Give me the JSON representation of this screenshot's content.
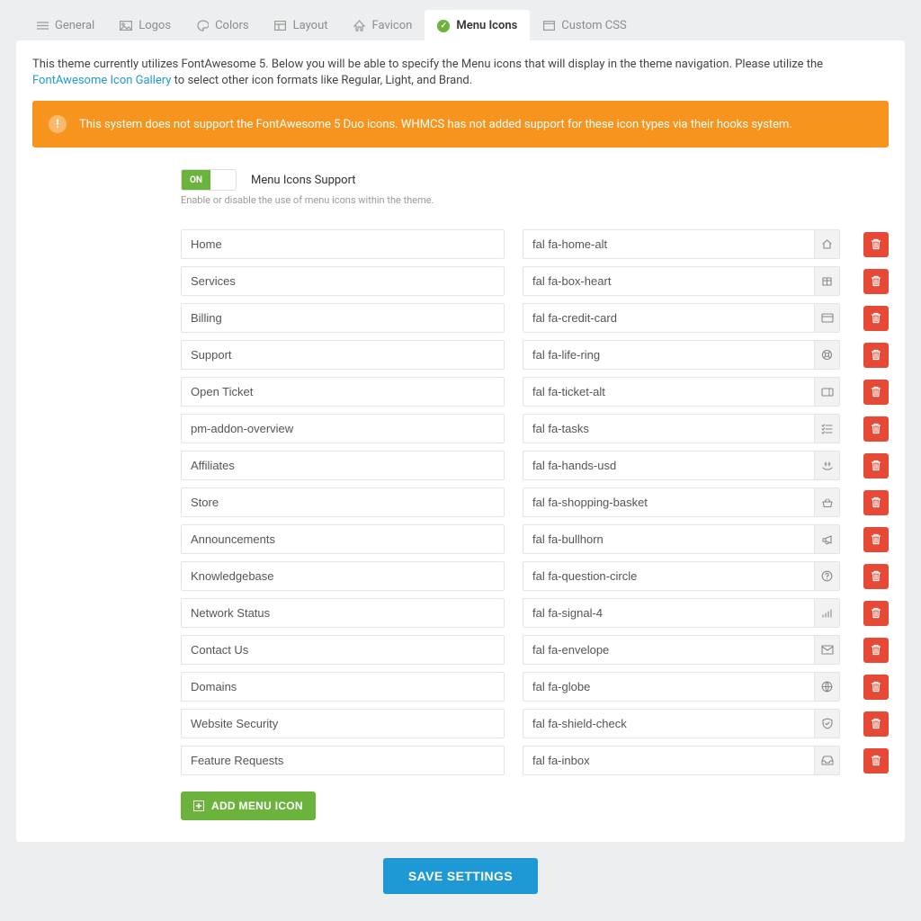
{
  "tabs": [
    {
      "id": "general",
      "label": "General"
    },
    {
      "id": "logos",
      "label": "Logos"
    },
    {
      "id": "colors",
      "label": "Colors"
    },
    {
      "id": "layout",
      "label": "Layout"
    },
    {
      "id": "favicon",
      "label": "Favicon"
    },
    {
      "id": "menu-icons",
      "label": "Menu Icons",
      "active": true
    },
    {
      "id": "custom-css",
      "label": "Custom CSS"
    }
  ],
  "intro": {
    "before": "This theme currently utilizes FontAwesome 5. Below you will be able to specify the Menu icons that will display in the theme navigation. Please utilize the ",
    "link": "FontAwesome Icon Gallery",
    "after": " to select other icon formats like Regular, Light, and Brand."
  },
  "alert": "This system does not support the FontAwesome 5 Duo icons. WHMCS has not added support for these icon types via their hooks system.",
  "toggle": {
    "state": "ON",
    "label": "Menu Icons Support",
    "hint": "Enable or disable the use of menu icons within the theme."
  },
  "rows": [
    {
      "name": "Home",
      "icon": "fal fa-home-alt",
      "glyph": "home"
    },
    {
      "name": "Services",
      "icon": "fal fa-box-heart",
      "glyph": "box"
    },
    {
      "name": "Billing",
      "icon": "fal fa-credit-card",
      "glyph": "card"
    },
    {
      "name": "Support",
      "icon": "fal fa-life-ring",
      "glyph": "ring"
    },
    {
      "name": "Open Ticket",
      "icon": "fal fa-ticket-alt",
      "glyph": "ticket"
    },
    {
      "name": "pm-addon-overview",
      "icon": "fal fa-tasks",
      "glyph": "tasks"
    },
    {
      "name": "Affiliates",
      "icon": "fal fa-hands-usd",
      "glyph": "hands"
    },
    {
      "name": "Store",
      "icon": "fal fa-shopping-basket",
      "glyph": "basket"
    },
    {
      "name": "Announcements",
      "icon": "fal fa-bullhorn",
      "glyph": "horn"
    },
    {
      "name": "Knowledgebase",
      "icon": "fal fa-question-circle",
      "glyph": "question"
    },
    {
      "name": "Network Status",
      "icon": "fal fa-signal-4",
      "glyph": "signal"
    },
    {
      "name": "Contact Us",
      "icon": "fal fa-envelope",
      "glyph": "envelope"
    },
    {
      "name": "Domains",
      "icon": "fal fa-globe",
      "glyph": "globe"
    },
    {
      "name": "Website Security",
      "icon": "fal fa-shield-check",
      "glyph": "shield"
    },
    {
      "name": "Feature Requests",
      "icon": "fal fa-inbox",
      "glyph": "inbox"
    }
  ],
  "buttons": {
    "add": "ADD MENU ICON",
    "save": "SAVE SETTINGS"
  }
}
